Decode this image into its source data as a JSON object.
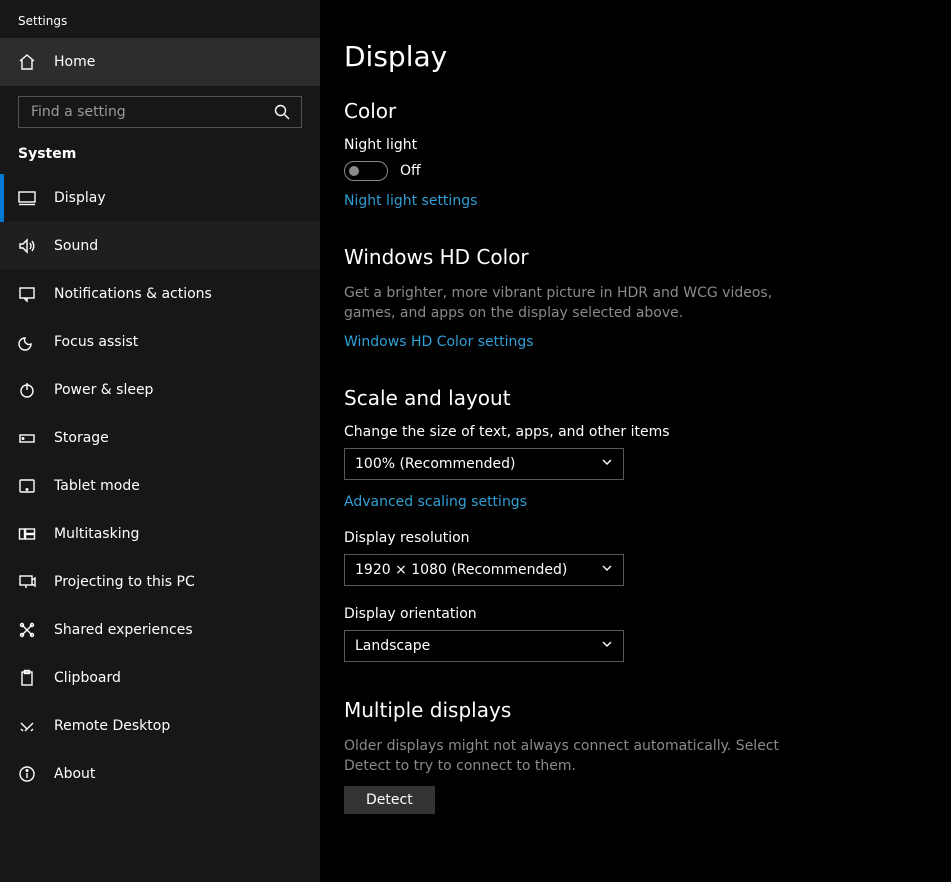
{
  "app": {
    "title": "Settings"
  },
  "sidebar": {
    "home_label": "Home",
    "search_placeholder": "Find a setting",
    "section_title": "System",
    "items": [
      {
        "label": "Display"
      },
      {
        "label": "Sound"
      },
      {
        "label": "Notifications & actions"
      },
      {
        "label": "Focus assist"
      },
      {
        "label": "Power & sleep"
      },
      {
        "label": "Storage"
      },
      {
        "label": "Tablet mode"
      },
      {
        "label": "Multitasking"
      },
      {
        "label": "Projecting to this PC"
      },
      {
        "label": "Shared experiences"
      },
      {
        "label": "Clipboard"
      },
      {
        "label": "Remote Desktop"
      },
      {
        "label": "About"
      }
    ]
  },
  "main": {
    "title": "Display",
    "color": {
      "heading": "Color",
      "night_light_label": "Night light",
      "night_light_state": "Off",
      "night_light_link": "Night light settings"
    },
    "hdcolor": {
      "heading": "Windows HD Color",
      "desc": "Get a brighter, more vibrant picture in HDR and WCG videos, games, and apps on the display selected above.",
      "link": "Windows HD Color settings"
    },
    "scale": {
      "heading": "Scale and layout",
      "size_label": "Change the size of text, apps, and other items",
      "size_value": "100% (Recommended)",
      "advanced_link": "Advanced scaling settings",
      "resolution_label": "Display resolution",
      "resolution_value": "1920 × 1080 (Recommended)",
      "orientation_label": "Display orientation",
      "orientation_value": "Landscape"
    },
    "multi": {
      "heading": "Multiple displays",
      "desc": "Older displays might not always connect automatically. Select Detect to try to connect to them.",
      "detect_label": "Detect"
    }
  }
}
